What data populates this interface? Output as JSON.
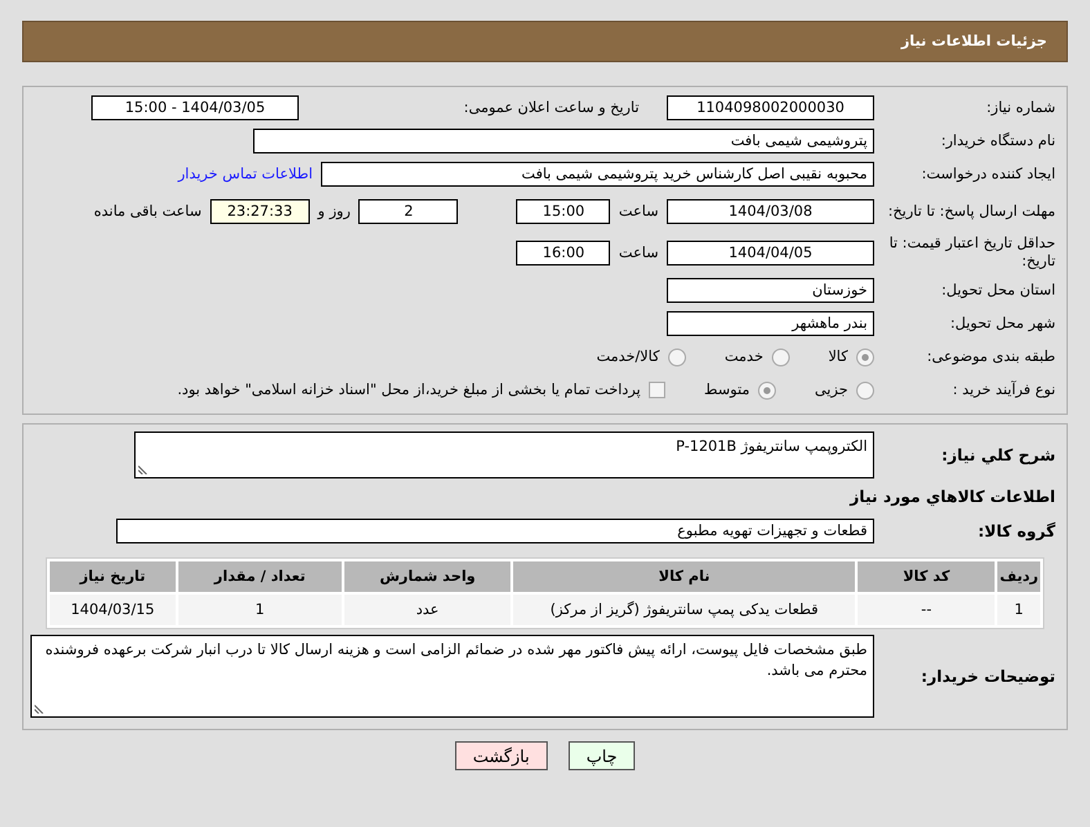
{
  "header": {
    "title": "جزئیات اطلاعات نیاز"
  },
  "need_number": {
    "label": "شماره نیاز:",
    "value": "1104098002000030"
  },
  "announce": {
    "label": "تاریخ و ساعت اعلان عمومی:",
    "value": "1404/03/05 - 15:00"
  },
  "buyer": {
    "label": "نام دستگاه خریدار:",
    "value": "پتروشیمی شیمی بافت"
  },
  "creator": {
    "label": "ایجاد کننده درخواست:",
    "value": "محبوبه نقیبی اصل کارشناس خرید پتروشیمی شیمی بافت",
    "link": "اطلاعات تماس خریدار"
  },
  "deadline": {
    "label": "مهلت ارسال پاسخ: تا تاریخ:",
    "date": "1404/03/08",
    "time_label": "ساعت",
    "time": "15:00",
    "days": "2",
    "days_label": "روز و",
    "remaining": "23:27:33",
    "remaining_label": "ساعت باقی مانده"
  },
  "validity": {
    "label": "حداقل تاریخ اعتبار قیمت: تا تاریخ:",
    "date": "1404/04/05",
    "time_label": "ساعت",
    "time": "16:00"
  },
  "province": {
    "label": "استان محل تحویل:",
    "value": "خوزستان"
  },
  "city": {
    "label": "شهر محل تحویل:",
    "value": "بندر ماهشهر"
  },
  "category": {
    "label": "طبقه بندی موضوعی:",
    "options": [
      {
        "label": "کالا",
        "selected": true
      },
      {
        "label": "خدمت",
        "selected": false
      },
      {
        "label": "کالا/خدمت",
        "selected": false
      }
    ]
  },
  "process": {
    "label": "نوع فرآیند خرید :",
    "options": [
      {
        "label": "جزیی",
        "selected": false
      },
      {
        "label": "متوسط",
        "selected": true
      }
    ],
    "payment": {
      "label": "پرداخت تمام یا بخشی از مبلغ خرید،از محل \"اسناد خزانه اسلامی\" خواهد بود.",
      "checked": false
    }
  },
  "description": {
    "label": "شرح کلي نياز:",
    "value": "الکتروپمپ سانتریفوژ P-1201B"
  },
  "goods_heading": "اطلاعات کالاهاي مورد نياز",
  "goods_group": {
    "label": "گروه کالا:",
    "value": "قطعات و تجهیزات تهویه مطبوع"
  },
  "table": {
    "columns": [
      "ردیف",
      "کد کالا",
      "نام کالا",
      "واحد شمارش",
      "تعداد / مقدار",
      "تاریخ نیاز"
    ],
    "rows": [
      [
        "1",
        "--",
        "قطعات یدکی پمپ سانتریفوژ (گریز از مرکز)",
        "عدد",
        "1",
        "1404/03/15"
      ]
    ]
  },
  "buyer_notes": {
    "label": "توضیحات خریدار:",
    "value": "طبق مشخصات فایل پیوست، ارائه پیش فاکتور مهر شده در ضمائم الزامی است و هزینه ارسال کالا تا درب انبار شرکت برعهده فروشنده محترم می باشد."
  },
  "buttons": [
    {
      "label": "چاپ",
      "kind": "print"
    },
    {
      "label": "بازگشت",
      "kind": "back"
    }
  ]
}
